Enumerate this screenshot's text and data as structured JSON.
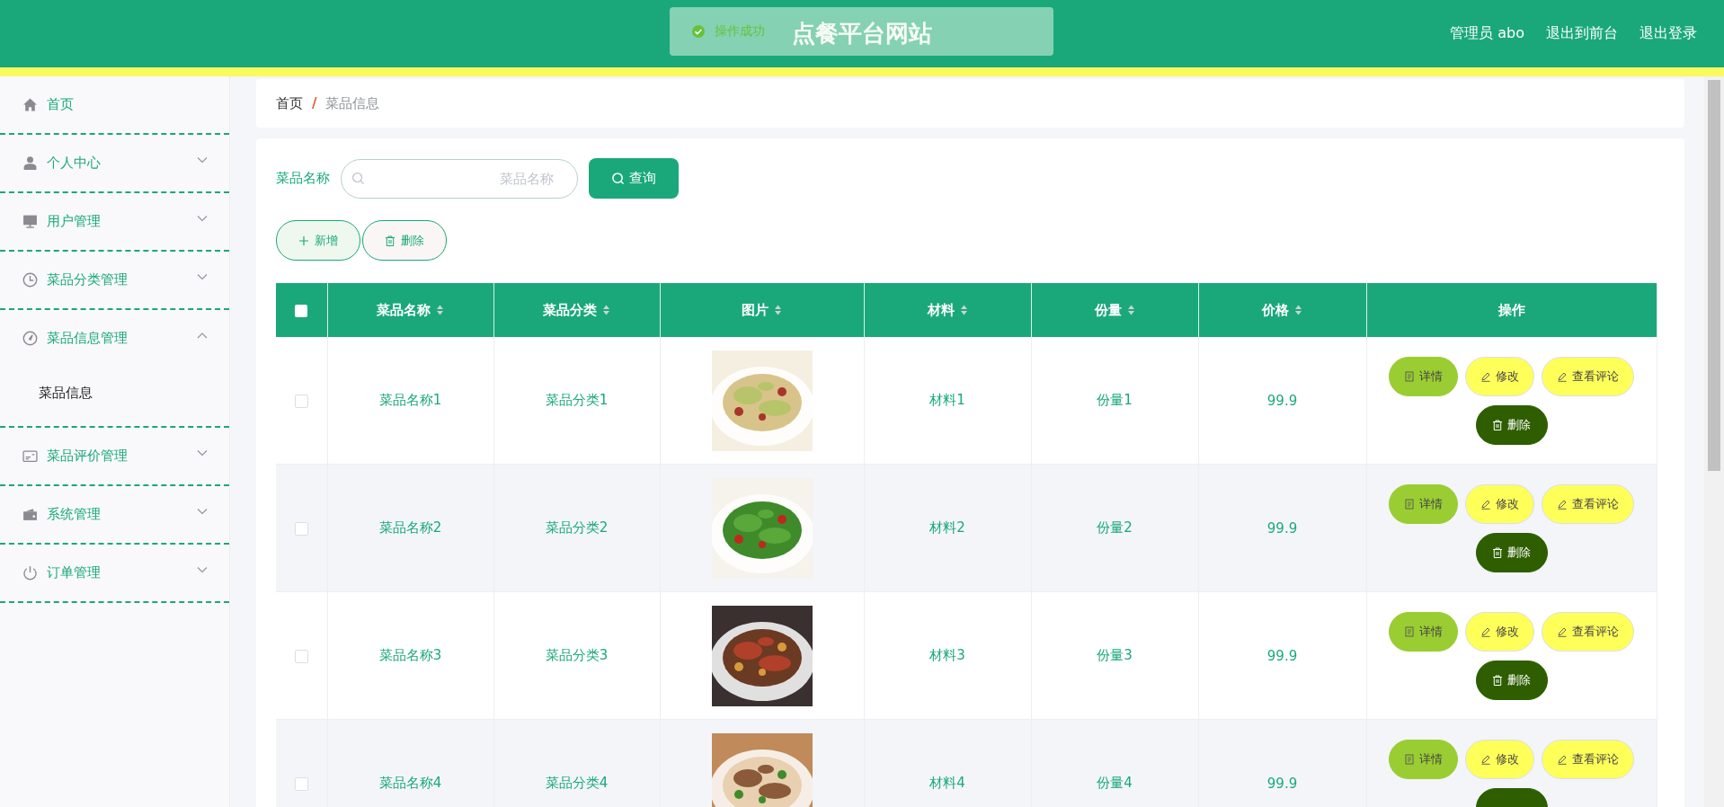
{
  "header": {
    "title": "点餐平台网站",
    "user": "管理员 abo",
    "links": [
      "退出到前台",
      "退出登录"
    ]
  },
  "toast": {
    "kind": "success",
    "message": "操作成功"
  },
  "sidebar": {
    "items": [
      {
        "label": "首页",
        "has_arrow": false
      },
      {
        "label": "个人中心",
        "expanded": false,
        "has_arrow": true
      },
      {
        "label": "用户管理",
        "expanded": false,
        "has_arrow": true
      },
      {
        "label": "菜品分类管理",
        "expanded": false,
        "has_arrow": true
      },
      {
        "label": "菜品信息管理",
        "expanded": true,
        "has_arrow": true,
        "children": [
          {
            "label": "菜品信息"
          }
        ]
      },
      {
        "label": "菜品评价管理",
        "expanded": false,
        "has_arrow": true
      },
      {
        "label": "系统管理",
        "expanded": false,
        "has_arrow": true
      },
      {
        "label": "订单管理",
        "expanded": false,
        "has_arrow": true
      }
    ]
  },
  "breadcrumb": {
    "items": [
      "首页",
      "菜品信息"
    ],
    "separator": "/"
  },
  "search": {
    "label": "菜品名称",
    "placeholder": "菜品名称",
    "button": "查询"
  },
  "actions": [
    {
      "label": "新增",
      "kind": "add"
    },
    {
      "label": "删除",
      "kind": "delete"
    }
  ],
  "table": {
    "select_all_checked": false,
    "columns": [
      {
        "label": "菜品名称",
        "sortable": true
      },
      {
        "label": "菜品分类",
        "sortable": true
      },
      {
        "label": "图片",
        "sortable": true
      },
      {
        "label": "材料",
        "sortable": true
      },
      {
        "label": "份量",
        "sortable": true
      },
      {
        "label": "价格",
        "sortable": true
      },
      {
        "label": "操作",
        "sortable": false
      }
    ],
    "rows": [
      {
        "checked": false,
        "name": "菜品名称1",
        "category": "菜品分类1",
        "material": "材料1",
        "quantity": "份量1",
        "price": "99.9",
        "buttons": [
          {
            "label": "详情",
            "kind": "detail"
          },
          {
            "label": "修改",
            "kind": "edit"
          },
          {
            "label": "查看评论",
            "kind": "comments"
          },
          {
            "label": "删除",
            "kind": "delete"
          }
        ]
      },
      {
        "checked": false,
        "name": "菜品名称2",
        "category": "菜品分类2",
        "material": "材料2",
        "quantity": "份量2",
        "price": "99.9",
        "buttons": [
          {
            "label": "详情",
            "kind": "detail"
          },
          {
            "label": "修改",
            "kind": "edit"
          },
          {
            "label": "查看评论",
            "kind": "comments"
          },
          {
            "label": "删除",
            "kind": "delete"
          }
        ]
      },
      {
        "checked": false,
        "name": "菜品名称3",
        "category": "菜品分类3",
        "material": "材料3",
        "quantity": "份量3",
        "price": "99.9",
        "buttons": [
          {
            "label": "详情",
            "kind": "detail"
          },
          {
            "label": "修改",
            "kind": "edit"
          },
          {
            "label": "查看评论",
            "kind": "comments"
          },
          {
            "label": "删除",
            "kind": "delete"
          }
        ]
      },
      {
        "checked": false,
        "name": "菜品名称4",
        "category": "菜品分类4",
        "material": "材料4",
        "quantity": "份量4",
        "price": "99.9",
        "buttons": [
          {
            "label": "详情",
            "kind": "detail"
          },
          {
            "label": "修改",
            "kind": "edit"
          },
          {
            "label": "查看评论",
            "kind": "comments"
          },
          {
            "kind": "delete"
          }
        ]
      }
    ]
  }
}
